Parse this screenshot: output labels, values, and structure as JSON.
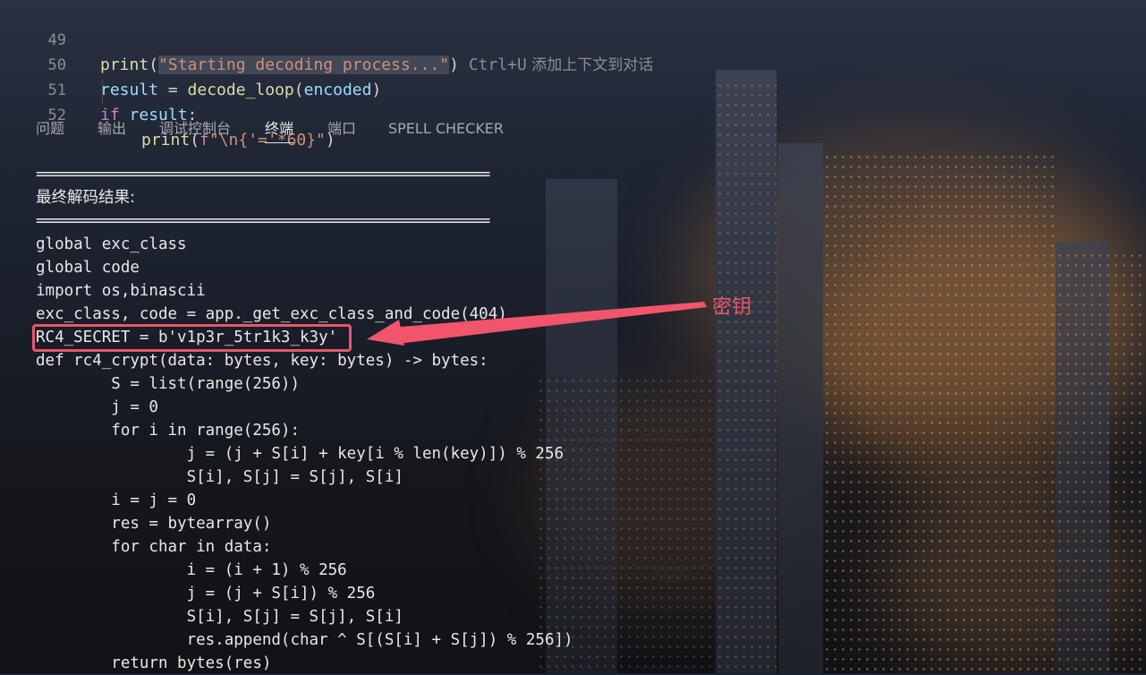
{
  "editor": {
    "lines": [
      {
        "number": "49",
        "fn": "print",
        "open": "(",
        "string": "\"Starting decoding process...\"",
        "close": ")",
        "hint_key": " Ctrl+U",
        "hint_text": " 添加上下文到对话"
      },
      {
        "number": "50",
        "var": "result",
        "eq": " = ",
        "fn": "decode_loop",
        "open": "(",
        "arg": "encoded",
        "close": ")"
      },
      {
        "number": "51",
        "kw": "if",
        "var": " result",
        "colon": ":"
      },
      {
        "number": "52",
        "fn": "print",
        "open": "(",
        "prefix": "f",
        "string": "\"\\n{'='*60}\"",
        "close": ")"
      }
    ]
  },
  "panel": {
    "tabs": [
      {
        "label": "问题",
        "active": false
      },
      {
        "label": "输出",
        "active": false
      },
      {
        "label": "调试控制台",
        "active": false
      },
      {
        "label": "终端",
        "active": true
      },
      {
        "label": "端口",
        "active": false
      },
      {
        "label": "SPELL CHECKER",
        "active": false
      }
    ]
  },
  "terminal": {
    "lines": [
      "============================================================",
      "最终解码结果:",
      "============================================================",
      "global exc_class",
      "global code",
      "import os,binascii",
      "exc_class, code = app._get_exc_class_and_code(404)",
      "RC4_SECRET = b'v1p3r_5tr1k3_k3y'",
      "def rc4_crypt(data: bytes, key: bytes) -> bytes:",
      "        S = list(range(256))",
      "        j = 0",
      "        for i in range(256):",
      "                j = (j + S[i] + key[i % len(key)]) % 256",
      "                S[i], S[j] = S[j], S[i]",
      "        i = j = 0",
      "        res = bytearray()",
      "        for char in data:",
      "                i = (i + 1) % 256",
      "                j = (j + S[i]) % 256",
      "                S[i], S[j] = S[j], S[i]",
      "                res.append(char ^ S[(S[i] + S[j]) % 256])",
      "        return bytes(res)"
    ]
  },
  "annotation": {
    "label": "密钥",
    "color": "#e8566b"
  }
}
